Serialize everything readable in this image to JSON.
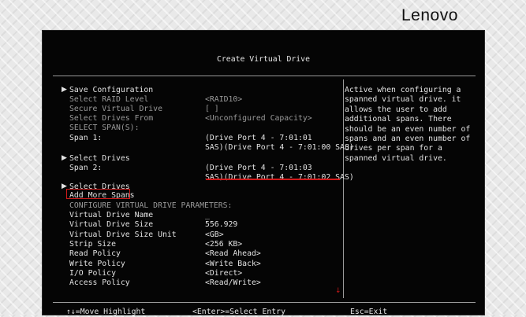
{
  "brand": {
    "logo": "Lenovo"
  },
  "window": {
    "title": "Create Virtual Drive"
  },
  "form": {
    "rows": [
      {
        "label": "Save Configuration",
        "value": "",
        "dim": false,
        "arrow": true
      },
      {
        "label": "Select RAID Level",
        "value": "<RAID10>",
        "dim": true,
        "arrow": false
      },
      {
        "label": "Secure Virtual Drive",
        "value": "[ ]",
        "dim": true,
        "arrow": false
      },
      {
        "label": "Select Drives From",
        "value": "<Unconfigured Capacity>",
        "dim": true,
        "arrow": false
      },
      {
        "label": "SELECT SPAN(S):",
        "value": "",
        "dim": true,
        "arrow": false
      },
      {
        "label": "Span 1:",
        "value": "(Drive Port 4 - 7:01:01",
        "dim": false,
        "arrow": false
      },
      {
        "label": "",
        "value": "SAS)(Drive Port 4 - 7:01:00 SAS)",
        "dim": false,
        "arrow": false
      },
      {
        "label": "Select Drives",
        "value": "",
        "dim": false,
        "arrow": true
      },
      {
        "label": "Span 2:",
        "value": "(Drive Port 4 - 7:01:03",
        "dim": false,
        "arrow": false
      },
      {
        "label": "",
        "value": "SAS)(Drive Port 4 - 7:01:02 SAS)",
        "dim": false,
        "arrow": false
      },
      {
        "label": "Select Drives",
        "value": "",
        "dim": false,
        "arrow": true
      },
      {
        "label": "Add More Spans",
        "value": "",
        "dim": false,
        "arrow": false
      },
      {
        "label": "CONFIGURE VIRTUAL DRIVE PARAMETERS:",
        "value": "",
        "dim": true,
        "arrow": false
      },
      {
        "label": "Virtual Drive Name",
        "value": "_",
        "dim": false,
        "arrow": false
      },
      {
        "label": "Virtual Drive Size",
        "value": "556.929",
        "dim": false,
        "arrow": false
      },
      {
        "label": "Virtual Drive Size Unit",
        "value": "<GB>",
        "dim": false,
        "arrow": false
      },
      {
        "label": "Strip Size",
        "value": "<256 KB>",
        "dim": false,
        "arrow": false
      },
      {
        "label": "Read Policy",
        "value": "<Read Ahead>",
        "dim": false,
        "arrow": false
      },
      {
        "label": "Write Policy",
        "value": "<Write Back>",
        "dim": false,
        "arrow": false
      },
      {
        "label": "I/O Policy",
        "value": "<Direct>",
        "dim": false,
        "arrow": false
      },
      {
        "label": "Access Policy",
        "value": "<Read/Write>",
        "dim": false,
        "arrow": false
      }
    ]
  },
  "help": {
    "text": "Active when configuring a\nspanned virtual drive. it\nallows the user to add\nadditional spans. There\nshould be an even number of\nspans and an even number of\ndrives per span for a\nspanned virtual drive."
  },
  "footer": {
    "move": "↑↓=Move Highlight",
    "select": "<Enter>=Select Entry",
    "exit": "Esc=Exit"
  },
  "colors": {
    "highlight": "#d11a1a",
    "text": "#e2e2e2",
    "dim": "#9a9a9a",
    "background": "#050505"
  },
  "icons": {
    "submenu": "right-triangle-icon",
    "scroll": "down-arrow-icon"
  }
}
